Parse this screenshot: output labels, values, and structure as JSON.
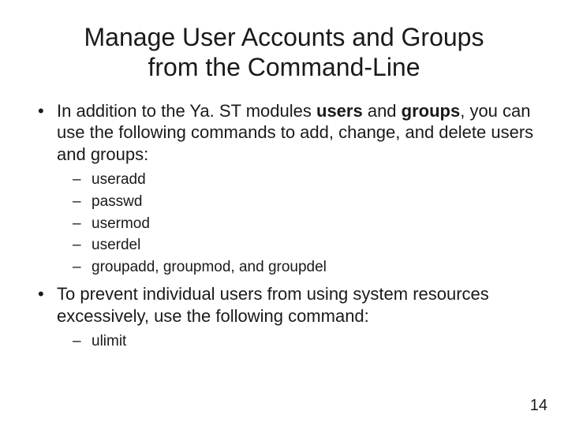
{
  "title_line1": "Manage User Accounts and Groups",
  "title_line2": "from the Command-Line",
  "bullet1_pre": "In addition to the Ya. ST modules ",
  "bullet1_b1": "users",
  "bullet1_mid": " and ",
  "bullet1_b2": "groups",
  "bullet1_post": ", you can use the following commands to add, change, and delete users and groups:",
  "sub1_1": "useradd",
  "sub1_2": "passwd",
  "sub1_3": "usermod",
  "sub1_4": "userdel",
  "sub1_5": "groupadd, groupmod, and groupdel",
  "bullet2": "To prevent individual users from using system resources excessively, use the following command:",
  "sub2_1": "ulimit",
  "page_number": "14"
}
